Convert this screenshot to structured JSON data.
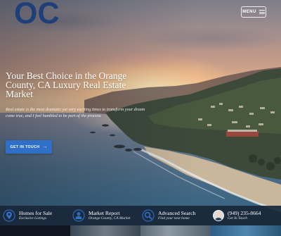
{
  "header": {
    "logo_text": "OC",
    "menu_label": "MENU"
  },
  "hero": {
    "headline": "Your Best Choice in the Orange County, CA Luxury Real Estate Market",
    "subtext": "Real estate is the most dramatic yet very exciting times to transform your dream come true, and I feel humbled to be part of the process.",
    "cta_label": "GET IN TOUCH"
  },
  "bottom_bar": {
    "items": [
      {
        "title": "Homes for Sale",
        "subtitle": "Exclusive Listings",
        "icon": "map-marker-icon"
      },
      {
        "title": "Market Report",
        "subtitle": "Orange County, CA Market",
        "icon": "report-icon"
      },
      {
        "title": "Advanced Search",
        "subtitle": "Find your next home",
        "icon": "search-icon"
      },
      {
        "title": "(949) 235-8664",
        "subtitle": "Get In Touch",
        "icon": "avatar"
      }
    ]
  },
  "colors": {
    "brand_navy": "#1e3f78",
    "accent_blue": "#2f6fc7",
    "bar_bg": "#192638"
  }
}
